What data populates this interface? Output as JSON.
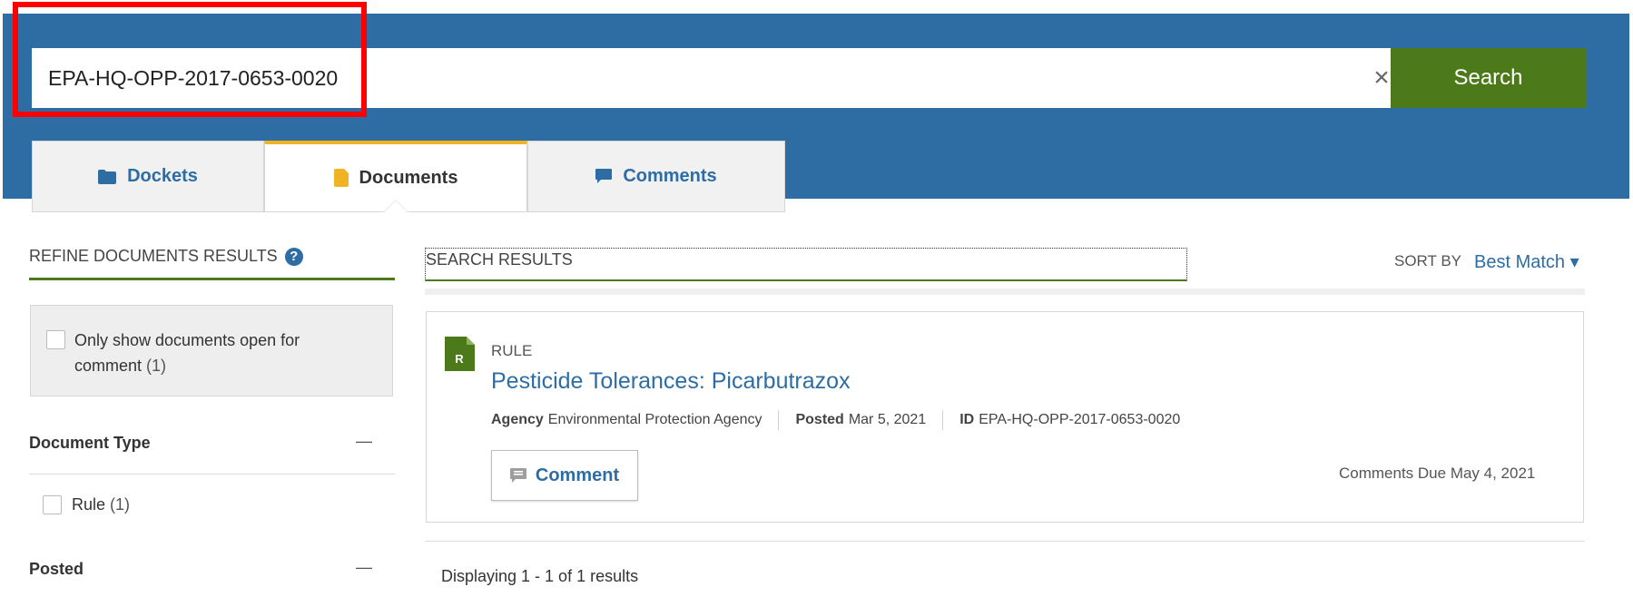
{
  "search": {
    "value": "EPA-HQ-OPP-2017-0653-0020",
    "clear_icon": "×",
    "button_label": "Search"
  },
  "tabs": [
    {
      "label": "Dockets",
      "icon": "folder-icon",
      "active": false
    },
    {
      "label": "Documents",
      "icon": "document-icon",
      "active": true
    },
    {
      "label": "Comments",
      "icon": "comment-icon",
      "active": false
    }
  ],
  "sidebar": {
    "title": "REFINE DOCUMENTS RESULTS",
    "help_icon": "?",
    "open_for_comment": {
      "label": "Only show documents open for comment",
      "count": "(1)"
    },
    "facets": [
      {
        "title": "Document Type",
        "collapse": "—",
        "options": [
          {
            "label": "Rule",
            "count": "(1)"
          }
        ]
      },
      {
        "title": "Posted",
        "collapse": "—"
      }
    ]
  },
  "results": {
    "header": "SEARCH RESULTS",
    "sort_by_label": "SORT BY",
    "sort_value": "Best Match ▾",
    "items": [
      {
        "icon_letter": "R",
        "type": "RULE",
        "title": "Pesticide Tolerances: Picarbutrazox",
        "agency_label": "Agency",
        "agency": "Environmental Protection Agency",
        "posted_label": "Posted",
        "posted": "Mar 5, 2021",
        "id_label": "ID",
        "id": "EPA-HQ-OPP-2017-0653-0020",
        "comment_button": "Comment",
        "comments_due": "Comments Due May 4, 2021"
      }
    ],
    "displaying": "Displaying 1 - 1 of 1 results"
  },
  "colors": {
    "header_blue": "#2e6da4",
    "search_green": "#4c7a1b",
    "active_tab_accent": "#f0b323",
    "highlight_red": "#ff0000"
  }
}
